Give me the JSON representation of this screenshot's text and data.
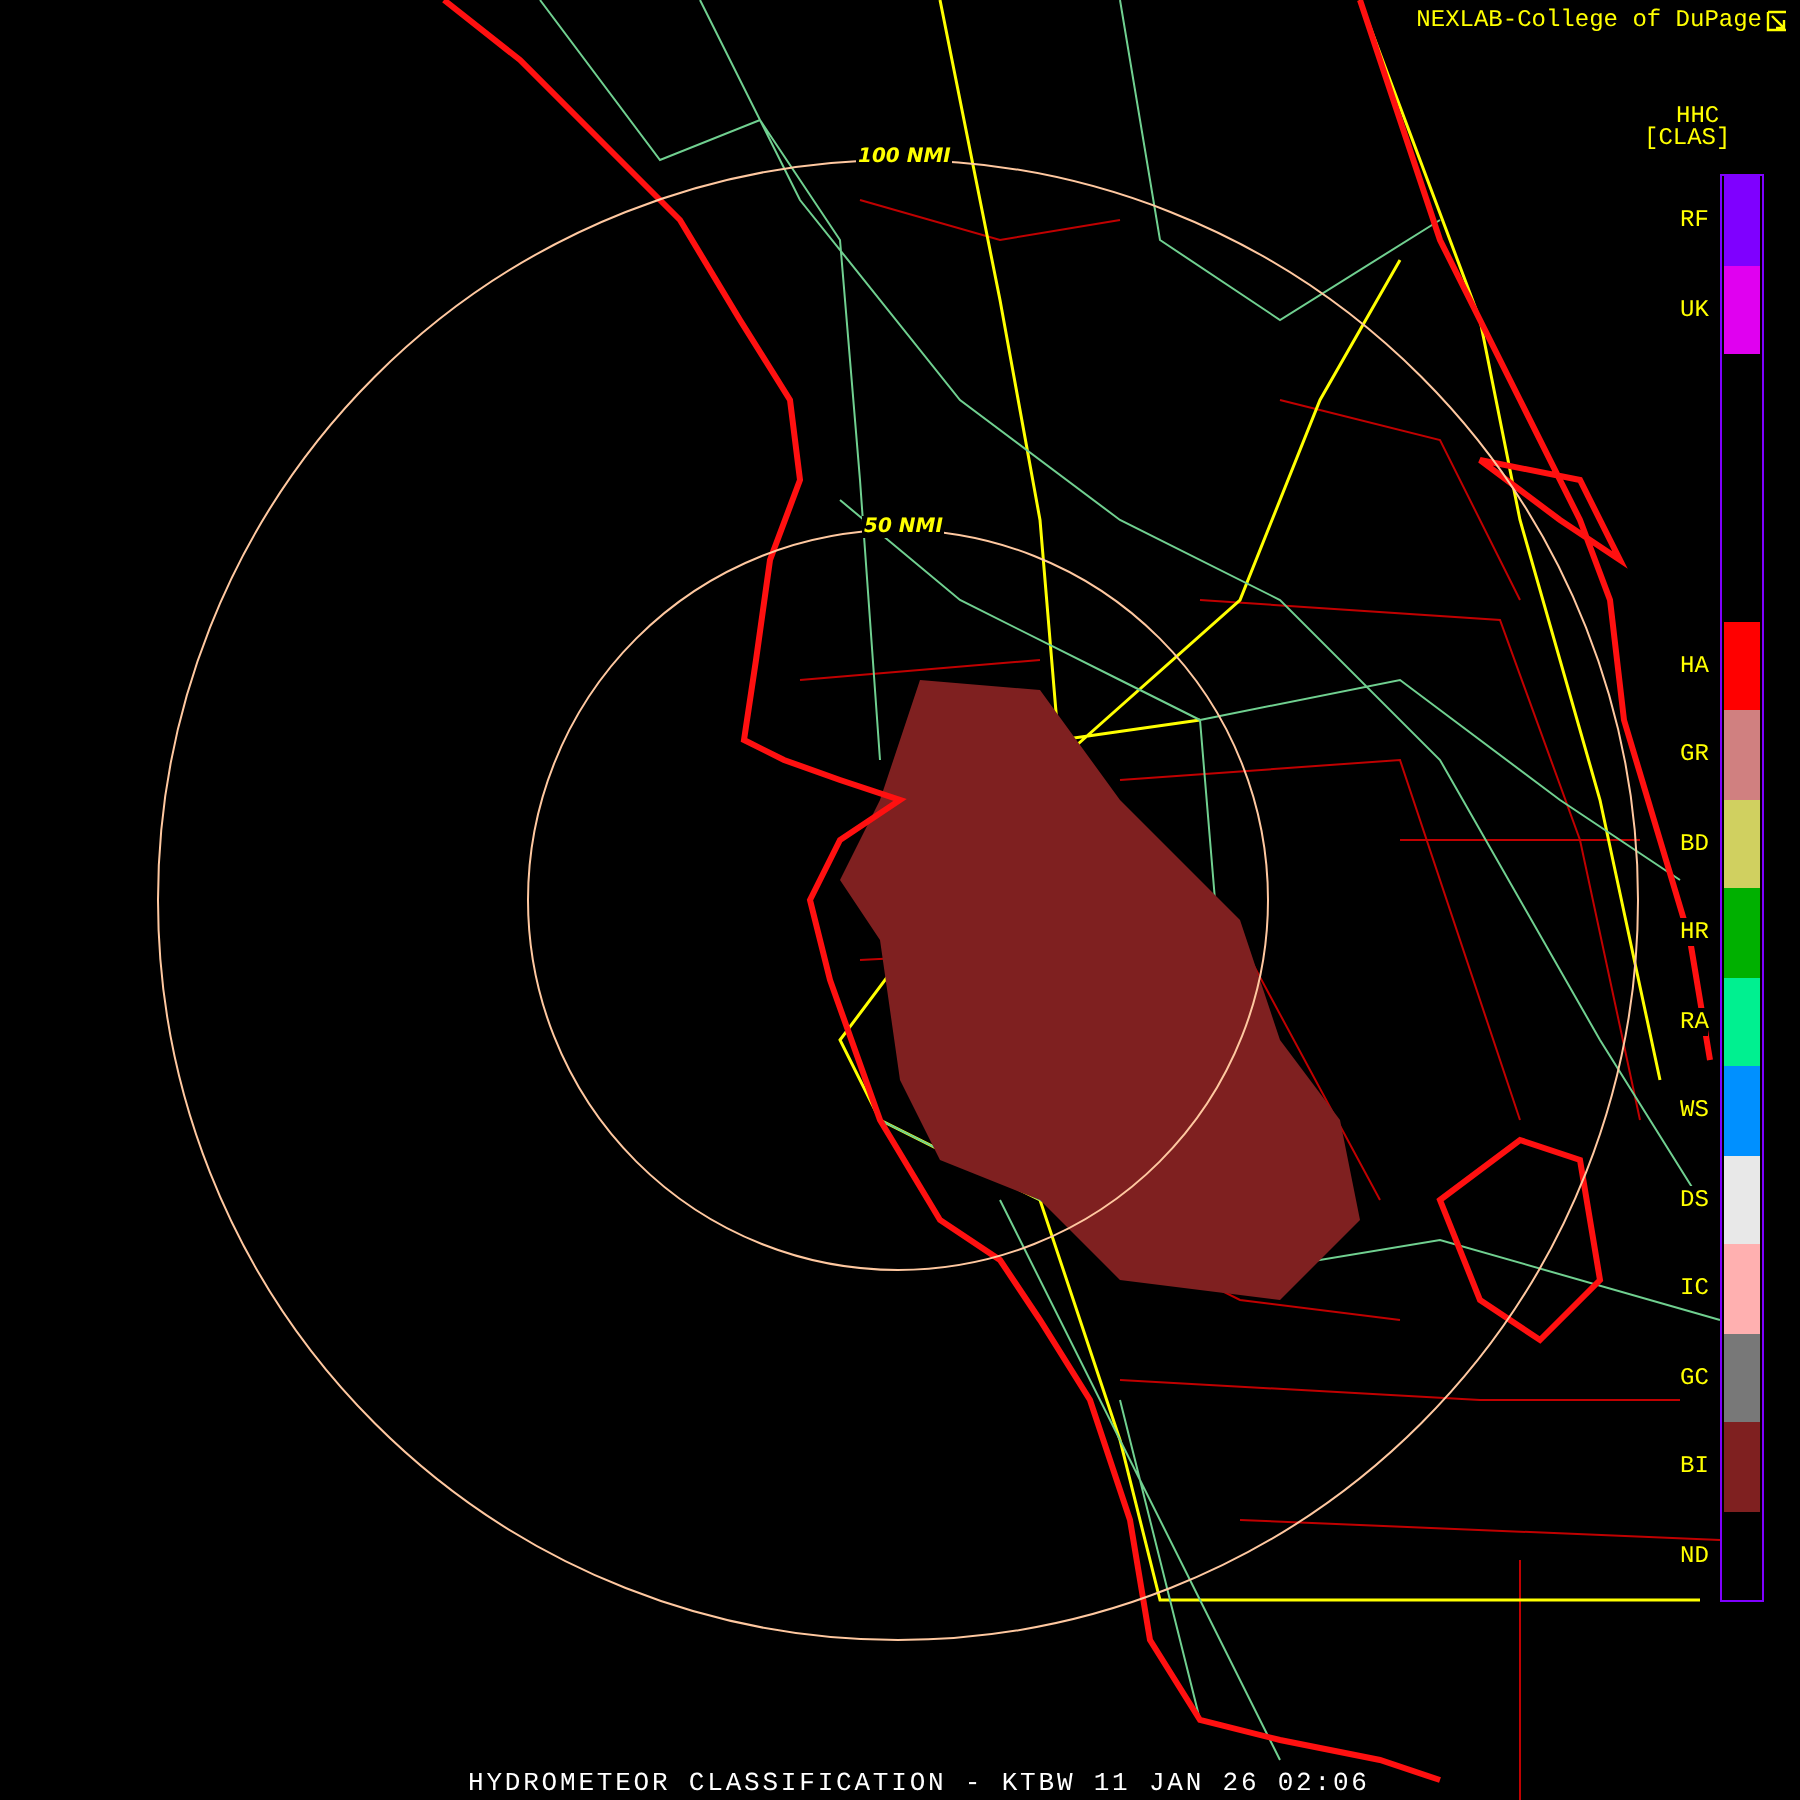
{
  "header": {
    "credit": "NEXLAB-College of DuPage"
  },
  "map": {
    "outer_ring_label": "100 NMI",
    "inner_ring_label": "50 NMI"
  },
  "legend": {
    "product": "HHC",
    "unit": "[CLAS]",
    "classes": [
      {
        "kind": "class",
        "label": "RF",
        "color": "#7f00ff"
      },
      {
        "kind": "class",
        "label": "UK",
        "color": "#e000f0"
      },
      {
        "kind": "gap"
      },
      {
        "kind": "gap"
      },
      {
        "kind": "gap"
      },
      {
        "kind": "class",
        "label": "HA",
        "color": "#ff0000"
      },
      {
        "kind": "class",
        "label": "GR",
        "color": "#d08080"
      },
      {
        "kind": "class",
        "label": "BD",
        "color": "#d0d060"
      },
      {
        "kind": "class",
        "label": "HR",
        "color": "#00b000"
      },
      {
        "kind": "class",
        "label": "RA",
        "color": "#00f090"
      },
      {
        "kind": "class",
        "label": "WS",
        "color": "#0090ff"
      },
      {
        "kind": "class",
        "label": "DS",
        "color": "#e8e8e8"
      },
      {
        "kind": "class",
        "label": "IC",
        "color": "#ffb0b0"
      },
      {
        "kind": "class",
        "label": "GC",
        "color": "#787878"
      },
      {
        "kind": "class",
        "label": "BI",
        "color": "#7f2020"
      },
      {
        "kind": "class",
        "label": "ND"
      }
    ]
  },
  "footer": "HYDROMETEOR CLASSIFICATION - KTBW 11 JAN 26 02:06"
}
